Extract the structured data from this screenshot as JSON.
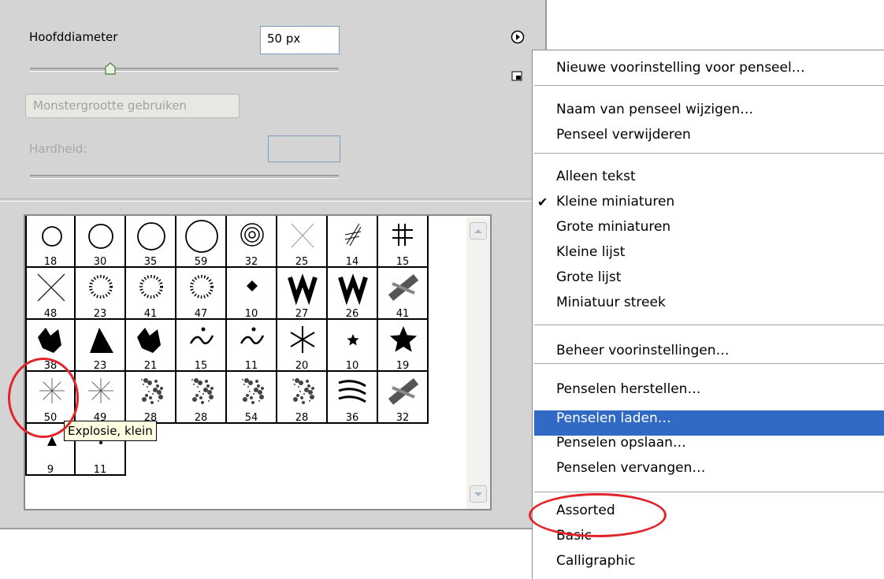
{
  "brush_panel": {
    "master_diameter_label": "Hoofddiameter",
    "master_diameter_value": "50 px",
    "master_diameter_slider_fraction": 0.26,
    "use_sample_size_label": "Monstergrootte gebruiken",
    "hardness_label": "Hardheid:",
    "hardness_value": ""
  },
  "brushes": [
    {
      "size": "18",
      "icon": "hard-round"
    },
    {
      "size": "30",
      "icon": "hard-round"
    },
    {
      "size": "35",
      "icon": "hard-round"
    },
    {
      "size": "59",
      "icon": "hard-round"
    },
    {
      "size": "32",
      "icon": "soft-round"
    },
    {
      "size": "25",
      "icon": "cross-soft"
    },
    {
      "size": "14",
      "icon": "hatch"
    },
    {
      "size": "15",
      "icon": "grid"
    },
    {
      "size": "48",
      "icon": "cross"
    },
    {
      "size": "23",
      "icon": "dotted-ring"
    },
    {
      "size": "41",
      "icon": "dotted-ring"
    },
    {
      "size": "47",
      "icon": "dotted-ring"
    },
    {
      "size": "10",
      "icon": "diamond"
    },
    {
      "size": "27",
      "icon": "zigzag"
    },
    {
      "size": "26",
      "icon": "zigzag"
    },
    {
      "size": "41",
      "icon": "smudge"
    },
    {
      "size": "38",
      "icon": "splash"
    },
    {
      "size": "23",
      "icon": "wedge"
    },
    {
      "size": "21",
      "icon": "splash"
    },
    {
      "size": "15",
      "icon": "squiggle"
    },
    {
      "size": "11",
      "icon": "squiggle"
    },
    {
      "size": "20",
      "icon": "snowflake"
    },
    {
      "size": "10",
      "icon": "star"
    },
    {
      "size": "19",
      "icon": "star"
    },
    {
      "size": "50",
      "icon": "starburst"
    },
    {
      "size": "49",
      "icon": "starburst"
    },
    {
      "size": "28",
      "icon": "spatter"
    },
    {
      "size": "28",
      "icon": "spatter"
    },
    {
      "size": "54",
      "icon": "spatter"
    },
    {
      "size": "28",
      "icon": "spatter"
    },
    {
      "size": "36",
      "icon": "claws"
    },
    {
      "size": "32",
      "icon": "smudge"
    },
    {
      "size": "9",
      "icon": "triangle"
    },
    {
      "size": "11",
      "icon": "dot"
    }
  ],
  "tooltip": "Explosie, klein",
  "menu": {
    "items": [
      "Nieuwe voorinstelling voor penseel…",
      "Naam van penseel wijzigen…",
      "Penseel verwijderen",
      "Alleen tekst",
      "Kleine miniaturen",
      "Grote miniaturen",
      "Kleine lijst",
      "Grote lijst",
      "Miniatuur streek",
      "Beheer voorinstellingen…",
      "Penselen herstellen…",
      "Penselen laden…",
      "Penselen opslaan…",
      "Penselen vervangen…",
      "Assorted",
      "Basic",
      "Calligraphic"
    ],
    "checkmark": "✔",
    "checked_item": "Kleine miniaturen",
    "highlighted_item": "Penselen laden…"
  },
  "colors": {
    "highlight": "#316ac5",
    "annotation": "#e3242b",
    "panel": "#d4d4d4"
  }
}
